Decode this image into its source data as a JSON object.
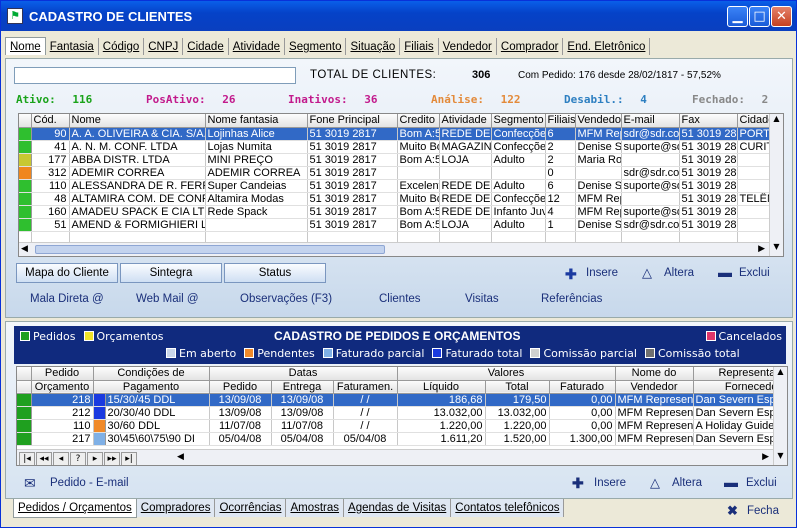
{
  "window": {
    "title": "CADASTRO DE CLIENTES"
  },
  "search_tabs": [
    "Nome",
    "Fantasia",
    "Código",
    "CNPJ",
    "Cidade",
    "Atividade",
    "Segmento",
    "Situação",
    "Filiais",
    "Vendedor",
    "Comprador",
    "End. Eletrônico"
  ],
  "summary": {
    "total_label": "TOTAL DE CLIENTES:",
    "total_value": "306",
    "com_pedido": "Com Pedido: 176 desde 28/02/1817 - 57,52%"
  },
  "stats": [
    {
      "label": "Ativo:",
      "value": "116",
      "color": "#1aa31a"
    },
    {
      "label": "PosAtivo:",
      "value": "26",
      "color": "#c21a8c"
    },
    {
      "label": "Inativos:",
      "value": "36",
      "color": "#c21a8c"
    },
    {
      "label": "Análise:",
      "value": "122",
      "color": "#e38a3a"
    },
    {
      "label": "Desabil.:",
      "value": "4",
      "color": "#2d7fc1"
    },
    {
      "label": "Fechado:",
      "value": "2",
      "color": "#888888"
    }
  ],
  "clients": {
    "headers": [
      "Cód.",
      "Nome",
      "Nome fantasia",
      "Fone Principal",
      "Credito",
      "Atividade",
      "Segmento",
      "Filiais",
      "Vendedor",
      "E-mail",
      "Fax",
      "Cidade"
    ],
    "rows": [
      {
        "ind": "#2fbf2f",
        "selected": true,
        "cells": [
          "90",
          "A. A. OLIVEIRA & CIA. S/A.",
          "Lojinhas Alice",
          "51 3019 2817",
          "Bom A:5",
          "REDE DE",
          "Confecções",
          "6",
          "MFM Repr",
          "sdr@sdr.com",
          "51 3019 281",
          "PORTO"
        ]
      },
      {
        "ind": "#2fbf2f",
        "cells": [
          "41",
          "A. N. M. CONF. LTDA",
          "Lojas Numita",
          "51 3019 2817",
          "Muito Bo",
          "MAGAZINE",
          "Confecções",
          "2",
          "Denise S",
          "suporte@sdr",
          "51 3019 281",
          "CURITIB"
        ]
      },
      {
        "ind": "#c8c832",
        "cells": [
          "177",
          "ABBA DISTR. LTDA",
          "MINI PREÇO",
          "51 3019 2817",
          "Bom A:5",
          "LOJA",
          "Adulto",
          "2",
          "Maria Ro",
          "",
          "51 3019 281",
          ""
        ]
      },
      {
        "ind": "#f0861e",
        "cells": [
          "312",
          "ADEMIR CORREA",
          "ADEMIR CORREA",
          "51 3019 2817",
          "",
          "",
          "",
          "0",
          "",
          "sdr@sdr.com",
          "51 3019 281",
          ""
        ]
      },
      {
        "ind": "#2fbf2f",
        "cells": [
          "110",
          "ALESSANDRA DE R. FERR",
          "Super Candeias",
          "51 3019 2817",
          "Excelent",
          "REDE DE",
          "Adulto",
          "6",
          "Denise S",
          "suporte@sdr",
          "51 3019 281",
          ""
        ]
      },
      {
        "ind": "#2fbf2f",
        "cells": [
          "48",
          "ALTAMIRA COM. DE CONF",
          "Altamira Modas",
          "51 3019 2817",
          "Muito Bo",
          "REDE DE",
          "Confecções",
          "12",
          "MFM Rep",
          "",
          "51 3019 281",
          "TELÊMA"
        ]
      },
      {
        "ind": "#2fbf2f",
        "cells": [
          "160",
          "AMADEU SPACK E CIA LTD",
          "Rede Spack",
          "51 3019 2817",
          "Bom A:5",
          "REDE DE",
          "Infanto Juv",
          "4",
          "MFM Repr",
          "suporte@sdr",
          "51 3019 281",
          ""
        ]
      },
      {
        "ind": "#2fbf2f",
        "cells": [
          "51",
          "AMEND & FORMIGHIERI LT",
          "",
          "51 3019 2817",
          "Bom A:5",
          "LOJA",
          "Adulto",
          "1",
          "Denise S",
          "sdr@sdr.com",
          "51 3019 281",
          ""
        ]
      }
    ]
  },
  "buttons": {
    "mapa": "Mapa do Cliente",
    "sintegra": "Sintegra",
    "status": "Status",
    "insere": "Insere",
    "altera": "Altera",
    "exclui": "Exclui"
  },
  "links": [
    "Mala Direta @",
    "Web Mail @",
    "Observações (F3)",
    "Clientes",
    "Visitas",
    "Referências"
  ],
  "orders": {
    "title": "CADASTRO DE PEDIDOS E ORÇAMENTOS",
    "legend_left": [
      {
        "label": "Pedidos",
        "color": "#1fa01f"
      },
      {
        "label": "Orçamentos",
        "color": "#f0e32a"
      }
    ],
    "legend_right": {
      "label": "Cancelados",
      "color": "#e0366a"
    },
    "legend_row": [
      {
        "label": "Em aberto",
        "color": "#c9d6ea"
      },
      {
        "label": "Pendentes",
        "color": "#f08a2a"
      },
      {
        "label": "Faturado parcial",
        "color": "#7fb0e6"
      },
      {
        "label": "Faturado total",
        "color": "#1a3ae0"
      },
      {
        "label": "Comissão parcial",
        "color": "#d0d0d0"
      },
      {
        "label": "Comissão total",
        "color": "#707070"
      }
    ],
    "group_headers": [
      "Pedido",
      "Condições de",
      "Datas",
      "Valores",
      "Nome do",
      "Representada"
    ],
    "headers": [
      "Orçamento",
      "Pagamento",
      "Pedido",
      "Entrega",
      "Faturamen.",
      "Líquido",
      "Total",
      "Faturado",
      "Vendedor",
      "Fornecedor"
    ],
    "rows": [
      {
        "ind": "#1fa01f",
        "ind2": "#1a3ae0",
        "selected": true,
        "cells": [
          "218",
          "15/30/45 DDL",
          "13/09/08",
          "13/09/08",
          "/ /",
          "186,68",
          "179,50",
          "0,00",
          "MFM Represen",
          "Dan Severn Esportes Ltd"
        ]
      },
      {
        "ind": "#1fa01f",
        "ind2": "#1a3ae0",
        "cells": [
          "212",
          "20/30/40 DDL",
          "13/09/08",
          "13/09/08",
          "/ /",
          "13.032,00",
          "13.032,00",
          "0,00",
          "MFM Represen",
          "Dan Severn Esportes Ltd"
        ]
      },
      {
        "ind": "#1fa01f",
        "ind2": "#f08a2a",
        "cells": [
          "110",
          "30/60 DDL",
          "11/07/08",
          "11/07/08",
          "/ /",
          "1.220,00",
          "1.220,00",
          "0,00",
          "MFM Represen",
          "A Holiday Guide Confecç"
        ]
      },
      {
        "ind": "#1fa01f",
        "ind2": "#7fb0e6",
        "cells": [
          "217",
          "30\\45\\60\\75\\90 DI",
          "05/04/08",
          "05/04/08",
          "05/04/08",
          "1.611,20",
          "1.520,00",
          "1.300,00",
          "MFM Represen",
          "Dan Severn Esportes Ltd"
        ]
      }
    ],
    "nav": [
      "|◂",
      "◂◂",
      "◂",
      "?",
      "▸",
      "▸▸",
      "▸|"
    ],
    "email_link": "Pedido - E-mail",
    "insere": "Insere",
    "altera": "Altera",
    "exclui": "Exclui"
  },
  "bottom_tabs": [
    "Pedidos / Orçamentos",
    "Compradores",
    "Ocorrências",
    "Amostras",
    "Agendas de Visitas",
    "Contatos telefônicos"
  ],
  "fecha": "Fecha"
}
